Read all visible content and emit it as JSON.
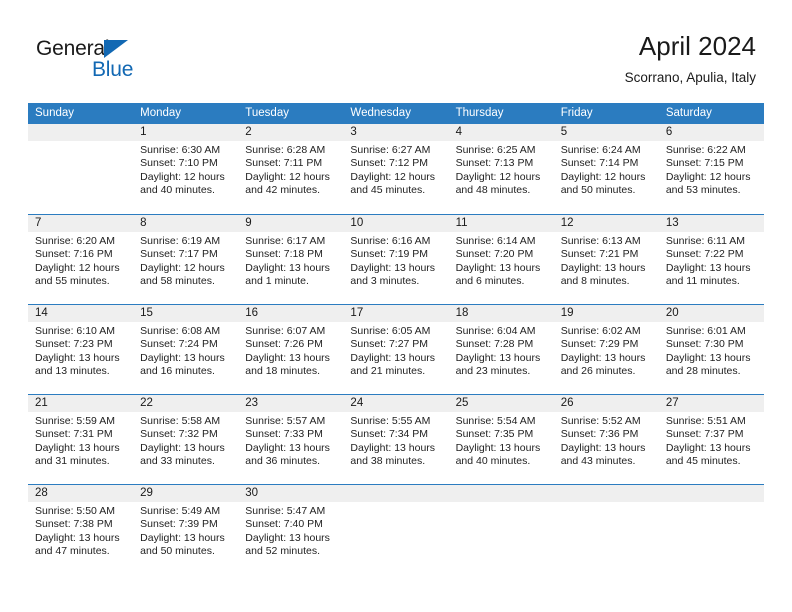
{
  "logo": {
    "word_top": "General",
    "word_bottom": "Blue",
    "triangle_color": "#1268b3"
  },
  "header": {
    "title": "April 2024",
    "subtitle": "Scorrano, Apulia, Italy"
  },
  "theme": {
    "header_blue": "#2b7cc0",
    "day_band_gray": "#efefef",
    "text_color": "#1a1a1a"
  },
  "calendar": {
    "weekday_labels": [
      "Sunday",
      "Monday",
      "Tuesday",
      "Wednesday",
      "Thursday",
      "Friday",
      "Saturday"
    ],
    "weeks": [
      [
        {
          "day": "",
          "sunrise": "",
          "sunset": "",
          "daylight": "",
          "empty": true
        },
        {
          "day": "1",
          "sunrise": "Sunrise: 6:30 AM",
          "sunset": "Sunset: 7:10 PM",
          "daylight": "Daylight: 12 hours and 40 minutes."
        },
        {
          "day": "2",
          "sunrise": "Sunrise: 6:28 AM",
          "sunset": "Sunset: 7:11 PM",
          "daylight": "Daylight: 12 hours and 42 minutes."
        },
        {
          "day": "3",
          "sunrise": "Sunrise: 6:27 AM",
          "sunset": "Sunset: 7:12 PM",
          "daylight": "Daylight: 12 hours and 45 minutes."
        },
        {
          "day": "4",
          "sunrise": "Sunrise: 6:25 AM",
          "sunset": "Sunset: 7:13 PM",
          "daylight": "Daylight: 12 hours and 48 minutes."
        },
        {
          "day": "5",
          "sunrise": "Sunrise: 6:24 AM",
          "sunset": "Sunset: 7:14 PM",
          "daylight": "Daylight: 12 hours and 50 minutes."
        },
        {
          "day": "6",
          "sunrise": "Sunrise: 6:22 AM",
          "sunset": "Sunset: 7:15 PM",
          "daylight": "Daylight: 12 hours and 53 minutes."
        }
      ],
      [
        {
          "day": "7",
          "sunrise": "Sunrise: 6:20 AM",
          "sunset": "Sunset: 7:16 PM",
          "daylight": "Daylight: 12 hours and 55 minutes."
        },
        {
          "day": "8",
          "sunrise": "Sunrise: 6:19 AM",
          "sunset": "Sunset: 7:17 PM",
          "daylight": "Daylight: 12 hours and 58 minutes."
        },
        {
          "day": "9",
          "sunrise": "Sunrise: 6:17 AM",
          "sunset": "Sunset: 7:18 PM",
          "daylight": "Daylight: 13 hours and 1 minute."
        },
        {
          "day": "10",
          "sunrise": "Sunrise: 6:16 AM",
          "sunset": "Sunset: 7:19 PM",
          "daylight": "Daylight: 13 hours and 3 minutes."
        },
        {
          "day": "11",
          "sunrise": "Sunrise: 6:14 AM",
          "sunset": "Sunset: 7:20 PM",
          "daylight": "Daylight: 13 hours and 6 minutes."
        },
        {
          "day": "12",
          "sunrise": "Sunrise: 6:13 AM",
          "sunset": "Sunset: 7:21 PM",
          "daylight": "Daylight: 13 hours and 8 minutes."
        },
        {
          "day": "13",
          "sunrise": "Sunrise: 6:11 AM",
          "sunset": "Sunset: 7:22 PM",
          "daylight": "Daylight: 13 hours and 11 minutes."
        }
      ],
      [
        {
          "day": "14",
          "sunrise": "Sunrise: 6:10 AM",
          "sunset": "Sunset: 7:23 PM",
          "daylight": "Daylight: 13 hours and 13 minutes."
        },
        {
          "day": "15",
          "sunrise": "Sunrise: 6:08 AM",
          "sunset": "Sunset: 7:24 PM",
          "daylight": "Daylight: 13 hours and 16 minutes."
        },
        {
          "day": "16",
          "sunrise": "Sunrise: 6:07 AM",
          "sunset": "Sunset: 7:26 PM",
          "daylight": "Daylight: 13 hours and 18 minutes."
        },
        {
          "day": "17",
          "sunrise": "Sunrise: 6:05 AM",
          "sunset": "Sunset: 7:27 PM",
          "daylight": "Daylight: 13 hours and 21 minutes."
        },
        {
          "day": "18",
          "sunrise": "Sunrise: 6:04 AM",
          "sunset": "Sunset: 7:28 PM",
          "daylight": "Daylight: 13 hours and 23 minutes."
        },
        {
          "day": "19",
          "sunrise": "Sunrise: 6:02 AM",
          "sunset": "Sunset: 7:29 PM",
          "daylight": "Daylight: 13 hours and 26 minutes."
        },
        {
          "day": "20",
          "sunrise": "Sunrise: 6:01 AM",
          "sunset": "Sunset: 7:30 PM",
          "daylight": "Daylight: 13 hours and 28 minutes."
        }
      ],
      [
        {
          "day": "21",
          "sunrise": "Sunrise: 5:59 AM",
          "sunset": "Sunset: 7:31 PM",
          "daylight": "Daylight: 13 hours and 31 minutes."
        },
        {
          "day": "22",
          "sunrise": "Sunrise: 5:58 AM",
          "sunset": "Sunset: 7:32 PM",
          "daylight": "Daylight: 13 hours and 33 minutes."
        },
        {
          "day": "23",
          "sunrise": "Sunrise: 5:57 AM",
          "sunset": "Sunset: 7:33 PM",
          "daylight": "Daylight: 13 hours and 36 minutes."
        },
        {
          "day": "24",
          "sunrise": "Sunrise: 5:55 AM",
          "sunset": "Sunset: 7:34 PM",
          "daylight": "Daylight: 13 hours and 38 minutes."
        },
        {
          "day": "25",
          "sunrise": "Sunrise: 5:54 AM",
          "sunset": "Sunset: 7:35 PM",
          "daylight": "Daylight: 13 hours and 40 minutes."
        },
        {
          "day": "26",
          "sunrise": "Sunrise: 5:52 AM",
          "sunset": "Sunset: 7:36 PM",
          "daylight": "Daylight: 13 hours and 43 minutes."
        },
        {
          "day": "27",
          "sunrise": "Sunrise: 5:51 AM",
          "sunset": "Sunset: 7:37 PM",
          "daylight": "Daylight: 13 hours and 45 minutes."
        }
      ],
      [
        {
          "day": "28",
          "sunrise": "Sunrise: 5:50 AM",
          "sunset": "Sunset: 7:38 PM",
          "daylight": "Daylight: 13 hours and 47 minutes."
        },
        {
          "day": "29",
          "sunrise": "Sunrise: 5:49 AM",
          "sunset": "Sunset: 7:39 PM",
          "daylight": "Daylight: 13 hours and 50 minutes."
        },
        {
          "day": "30",
          "sunrise": "Sunrise: 5:47 AM",
          "sunset": "Sunset: 7:40 PM",
          "daylight": "Daylight: 13 hours and 52 minutes."
        },
        {
          "day": "",
          "sunrise": "",
          "sunset": "",
          "daylight": "",
          "empty": true
        },
        {
          "day": "",
          "sunrise": "",
          "sunset": "",
          "daylight": "",
          "empty": true
        },
        {
          "day": "",
          "sunrise": "",
          "sunset": "",
          "daylight": "",
          "empty": true
        },
        {
          "day": "",
          "sunrise": "",
          "sunset": "",
          "daylight": "",
          "empty": true
        }
      ]
    ]
  }
}
